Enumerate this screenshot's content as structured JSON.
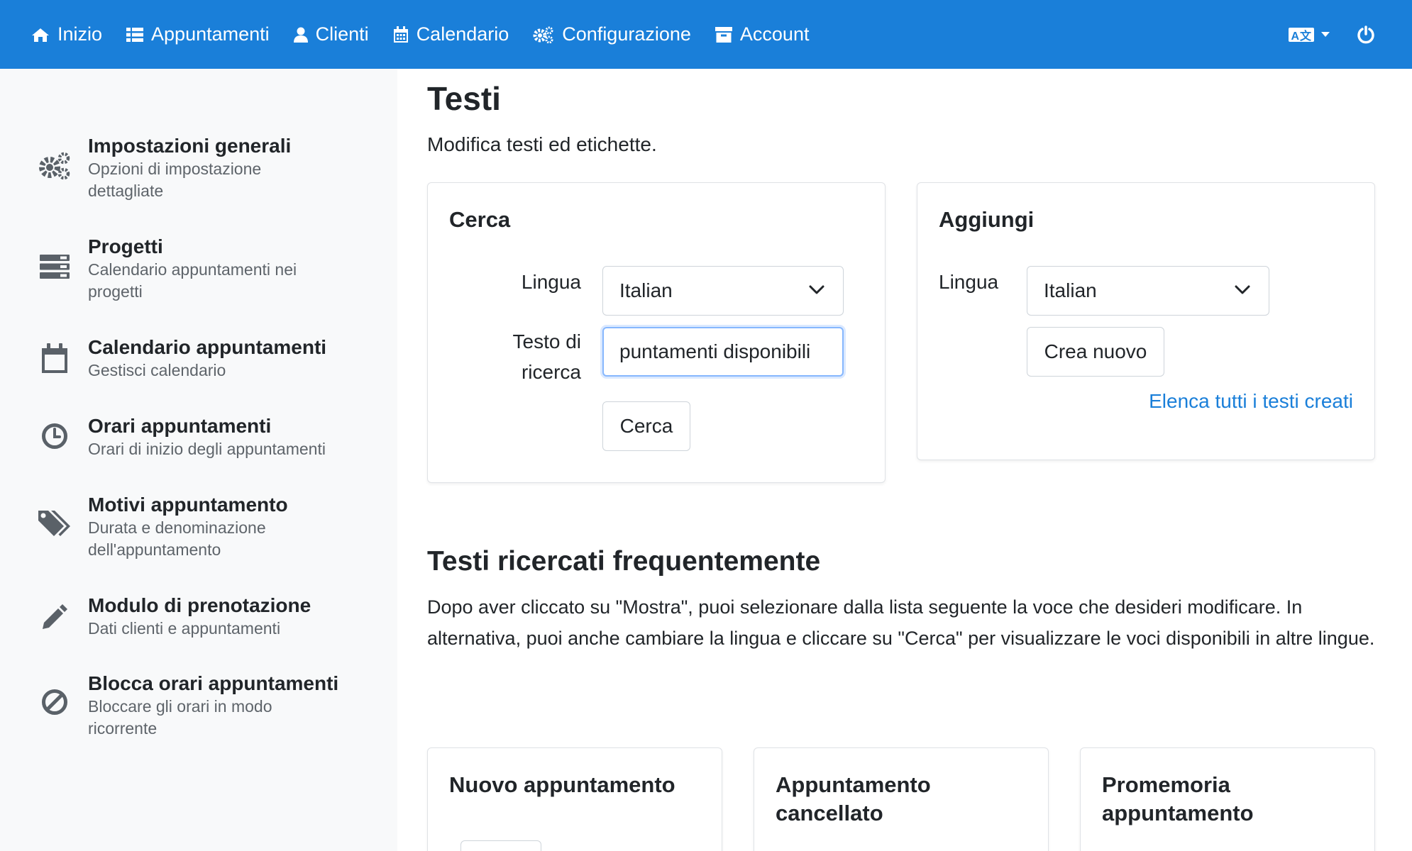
{
  "nav": {
    "items": [
      {
        "label": "Inizio",
        "icon": "home-icon"
      },
      {
        "label": "Appuntamenti",
        "icon": "list-icon"
      },
      {
        "label": "Clienti",
        "icon": "user-icon"
      },
      {
        "label": "Calendario",
        "icon": "calendar-icon"
      },
      {
        "label": "Configurazione",
        "icon": "cogs-icon"
      },
      {
        "label": "Account",
        "icon": "archive-icon"
      }
    ],
    "language_badge": "A文"
  },
  "sidebar": {
    "items": [
      {
        "title": "Impostazioni generali",
        "subtitle": "Opzioni di impostazione dettagliate",
        "icon": "cogs-icon"
      },
      {
        "title": "Progetti",
        "subtitle": "Calendario appuntamenti nei progetti",
        "icon": "server-icon"
      },
      {
        "title": "Calendario appuntamenti",
        "subtitle": "Gestisci calendario",
        "icon": "calendar-icon"
      },
      {
        "title": "Orari appuntamenti",
        "subtitle": "Orari di inizio degli appuntamenti",
        "icon": "clock-icon"
      },
      {
        "title": "Motivi appuntamento",
        "subtitle": "Durata e denominazione dell'appuntamento",
        "icon": "tags-icon"
      },
      {
        "title": "Modulo di prenotazione",
        "subtitle": "Dati clienti e appuntamenti",
        "icon": "pencil-icon"
      },
      {
        "title": "Blocca orari appuntamenti",
        "subtitle": "Bloccare gli orari in modo ricorrente",
        "icon": "ban-icon"
      }
    ]
  },
  "page": {
    "title": "Testi",
    "lead": "Modifica testi ed etichette."
  },
  "search_card": {
    "title": "Cerca",
    "language_label": "Lingua",
    "language_value": "Italian",
    "search_label": "Testo di ricerca",
    "search_value": "puntamenti disponibili",
    "search_button": "Cerca"
  },
  "add_card": {
    "title": "Aggiungi",
    "language_label": "Lingua",
    "language_value": "Italian",
    "create_button": "Crea nuovo",
    "list_link": "Elenca tutti i testi creati"
  },
  "frequent": {
    "title": "Testi ricercati frequentemente",
    "description": "Dopo aver cliccato su \"Mostra\", puoi selezionare dalla lista seguente la voce che desideri modificare. In alternativa, puoi anche cambiare la lingua e cliccare su \"Cerca\" per visualizzare le voci disponibili in altre lingue.",
    "cards": [
      {
        "title": "Nuovo appuntamento"
      },
      {
        "title": "Appuntamento cancellato"
      },
      {
        "title": "Promemoria appuntamento"
      }
    ]
  }
}
